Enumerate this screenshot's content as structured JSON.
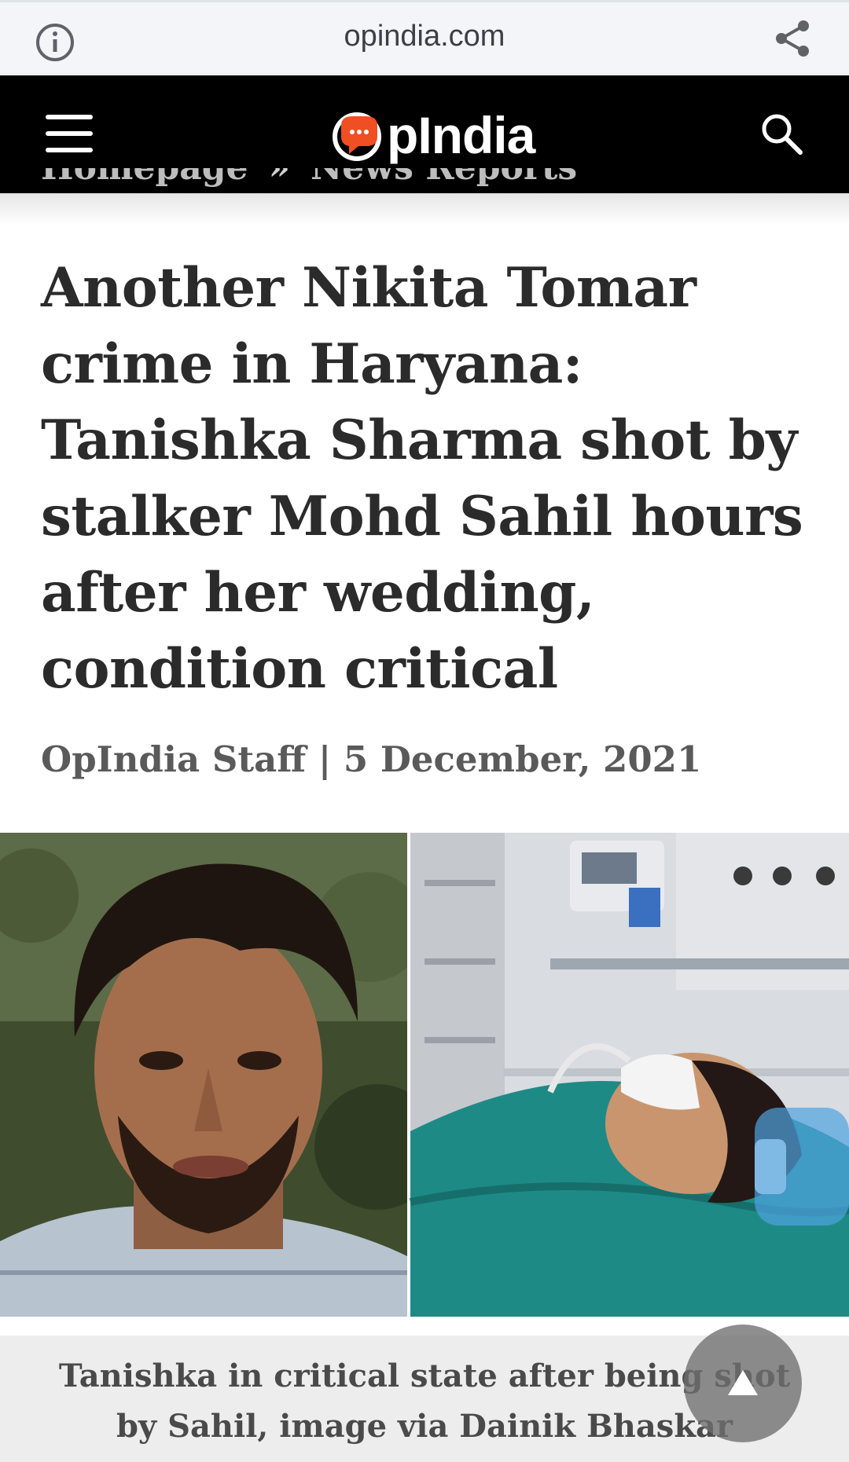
{
  "browser": {
    "domain": "opindia.com",
    "info_icon": "info-circle-icon",
    "share_icon": "share-icon"
  },
  "site_header": {
    "menu_icon": "hamburger-menu-icon",
    "logo_text": "pIndia",
    "search_icon": "search-icon",
    "brand_color": "#f04e23"
  },
  "breadcrumb": {
    "items": [
      "Homepage",
      "News Reports"
    ],
    "separator": "»"
  },
  "article": {
    "title": "Another Nikita Tomar crime in Haryana: Tanishka Sharma shot by stalker Mohd Sahil hours after her wedding, condition critical",
    "byline": "OpIndia Staff | 5 December, 2021",
    "image_caption": "Tanishka in critical state after being shot by Sahil, image via Dainik Bhaskar"
  },
  "scroll_top": {
    "icon": "arrow-up-icon"
  }
}
